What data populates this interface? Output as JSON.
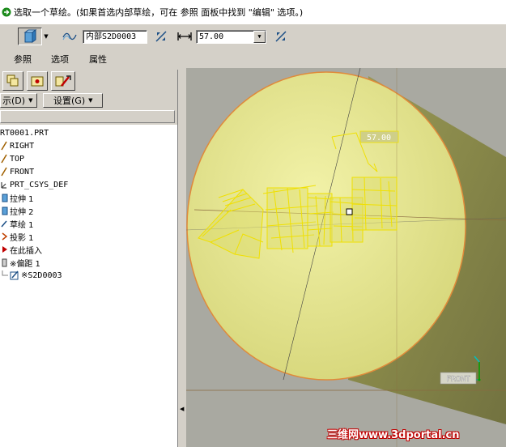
{
  "prompt": {
    "message": "选取一个草绘。(如果首选内部草绘，可在 参照 面板中找到 \"编辑\" 选项。)"
  },
  "dashboard": {
    "sketch_field": "内部S2D0003",
    "depth_value": "57.00",
    "tabs": [
      "参照",
      "选项",
      "属性"
    ]
  },
  "model_tree": {
    "menu_show": "示(D)",
    "menu_settings": "设置(G)",
    "items": [
      {
        "label": "RT0001.PRT",
        "icon": "part-icon"
      },
      {
        "label": "RIGHT",
        "icon": "datum-plane-icon"
      },
      {
        "label": "TOP",
        "icon": "datum-plane-icon"
      },
      {
        "label": "FRONT",
        "icon": "datum-plane-icon"
      },
      {
        "label": "PRT_CSYS_DEF",
        "icon": "csys-icon"
      },
      {
        "label": "拉伸 1",
        "icon": "extrude-icon"
      },
      {
        "label": "拉伸 2",
        "icon": "extrude-icon"
      },
      {
        "label": "草绘 1",
        "icon": "sketch-icon"
      },
      {
        "label": "投影 1",
        "icon": "project-icon"
      },
      {
        "label": "在此插入",
        "icon": "insert-here-icon"
      },
      {
        "label": "※偏距 1",
        "icon": "offset-icon"
      },
      {
        "label": "※S2D0003",
        "icon": "sketch-edit-icon"
      }
    ]
  },
  "graphics": {
    "dimension": "57.00",
    "view_label": "FRONT",
    "colors": {
      "background": "#a9a9a1",
      "cylinder_face": "#e6e68c",
      "cylinder_body": "#87874a",
      "selection": "#f0e000",
      "edge": "#e08a3a"
    }
  },
  "watermark": "三维网www.3dportal.cn"
}
